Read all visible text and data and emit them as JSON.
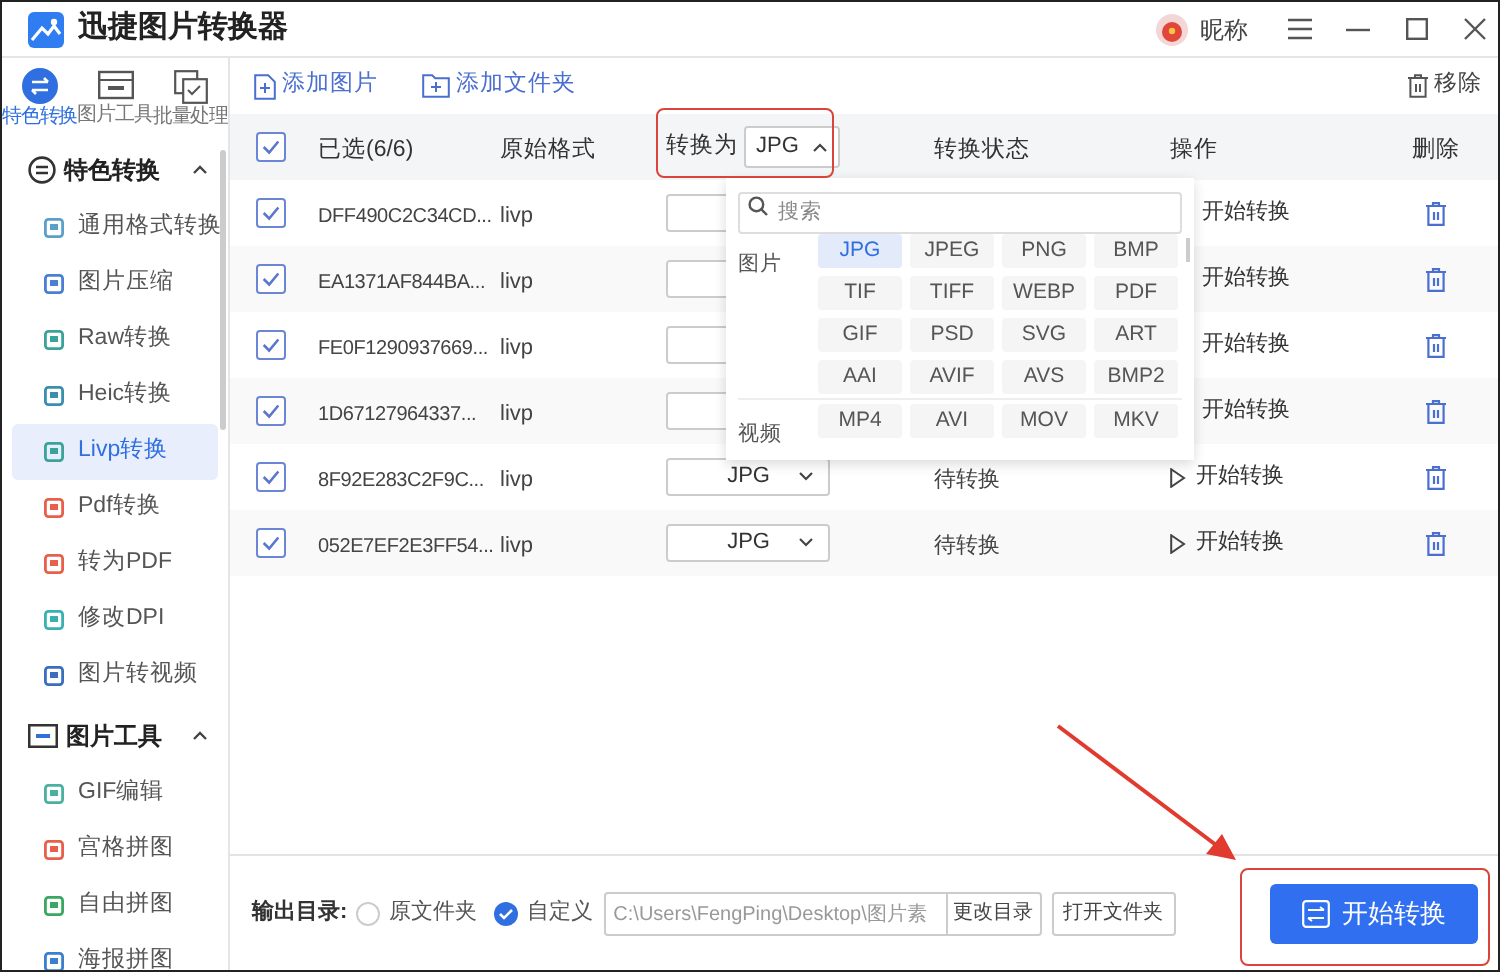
{
  "window": {
    "title": "迅捷图片转换器",
    "user": "昵称"
  },
  "sidebar": {
    "tabs": [
      {
        "label": "特色转换",
        "selected": true
      },
      {
        "label": "图片工具",
        "selected": false
      },
      {
        "label": "批量处理",
        "selected": false
      }
    ],
    "sections": [
      {
        "title": "特色转换",
        "expanded": true,
        "items": [
          {
            "label": "通用格式转换",
            "color": "#5aa0c8",
            "selected": false
          },
          {
            "label": "图片压缩",
            "color": "#4a7fd6",
            "selected": false
          },
          {
            "label": "Raw转换",
            "color": "#3aa39a",
            "selected": false
          },
          {
            "label": "Heic转换",
            "color": "#3a8fb0",
            "selected": false
          },
          {
            "label": "Livp转换",
            "color": "#3aa39a",
            "selected": true
          },
          {
            "label": "Pdf转换",
            "color": "#e8604a",
            "selected": false
          },
          {
            "label": "转为PDF",
            "color": "#e8604a",
            "selected": false
          },
          {
            "label": "修改DPI",
            "color": "#3ab0b0",
            "selected": false
          },
          {
            "label": "图片转视频",
            "color": "#3a6fc0",
            "selected": false
          }
        ]
      },
      {
        "title": "图片工具",
        "expanded": true,
        "items": [
          {
            "label": "GIF编辑",
            "color": "#4ab0a0",
            "selected": false
          },
          {
            "label": "宫格拼图",
            "color": "#e8604a",
            "selected": false
          },
          {
            "label": "自由拼图",
            "color": "#3aa860",
            "selected": false
          },
          {
            "label": "海报拼图",
            "color": "#3a7fd0",
            "selected": false
          }
        ]
      }
    ]
  },
  "toolbar": {
    "add_image": "添加图片",
    "add_folder": "添加文件夹",
    "remove": "移除"
  },
  "table": {
    "header": {
      "checked": true,
      "selected_count": "已选(6/6)",
      "original_format": "原始格式",
      "convert_to": "转换为",
      "target_format": "JPG",
      "dropdown_open": true,
      "status": "转换状态",
      "action": "操作",
      "delete": "删除"
    },
    "rows": [
      {
        "checked": true,
        "name": "DFF490C2C34CD...",
        "format": "livp",
        "action": "开始转换"
      },
      {
        "checked": true,
        "name": "EA1371AF844BA...",
        "format": "livp",
        "action": "开始转换"
      },
      {
        "checked": true,
        "name": "FE0F1290937669...",
        "format": "livp",
        "action": "开始转换"
      },
      {
        "checked": true,
        "name": "1D67127964337...",
        "format": "livp",
        "action": "开始转换"
      },
      {
        "checked": true,
        "name": "8F92E283C2F9C...",
        "format": "livp",
        "target": "JPG",
        "status": "待转换",
        "action": "开始转换"
      },
      {
        "checked": true,
        "name": "052E7EF2E3FF54...",
        "format": "livp",
        "target": "JPG",
        "status": "待转换",
        "action": "开始转换"
      }
    ]
  },
  "format_menu": {
    "search_placeholder": "搜索",
    "groups": [
      {
        "label": "图片",
        "options": [
          {
            "label": "JPG",
            "selected": true
          },
          {
            "label": "JPEG",
            "selected": false
          },
          {
            "label": "PNG",
            "selected": false
          },
          {
            "label": "BMP",
            "selected": false
          },
          {
            "label": "TIF",
            "selected": false
          },
          {
            "label": "TIFF",
            "selected": false
          },
          {
            "label": "WEBP",
            "selected": false
          },
          {
            "label": "PDF",
            "selected": false
          },
          {
            "label": "GIF",
            "selected": false
          },
          {
            "label": "PSD",
            "selected": false
          },
          {
            "label": "SVG",
            "selected": false
          },
          {
            "label": "ART",
            "selected": false
          },
          {
            "label": "AAI",
            "selected": false
          },
          {
            "label": "AVIF",
            "selected": false
          },
          {
            "label": "AVS",
            "selected": false
          },
          {
            "label": "BMP2",
            "selected": false
          }
        ]
      },
      {
        "label": "视频",
        "options": [
          {
            "label": "MP4",
            "selected": false
          },
          {
            "label": "AVI",
            "selected": false
          },
          {
            "label": "MOV",
            "selected": false
          },
          {
            "label": "MKV",
            "selected": false
          }
        ]
      }
    ]
  },
  "output": {
    "label": "输出目录:",
    "options": [
      {
        "label": "原文件夹",
        "selected": false
      },
      {
        "label": "自定义",
        "selected": true
      }
    ],
    "path": "C:\\Users\\FengPing\\Desktop\\图片素",
    "change_button": "更改目录",
    "open_button": "打开文件夹"
  },
  "start_button": "开始转换"
}
